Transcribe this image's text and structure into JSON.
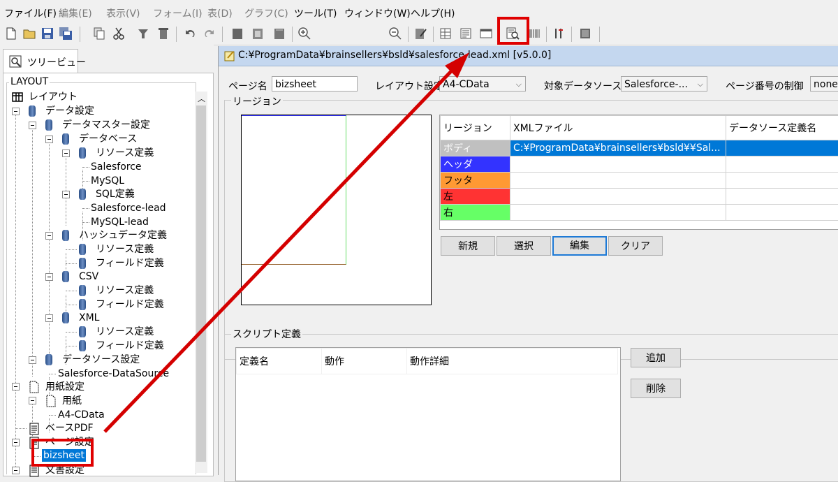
{
  "menu": [
    {
      "label": "ファイル(F)",
      "enabled": true
    },
    {
      "label": "編集(E)",
      "enabled": false
    },
    {
      "label": "表示(V)",
      "enabled": false
    },
    {
      "label": "フォーム(I)",
      "enabled": false
    },
    {
      "label": "表(D)",
      "enabled": false
    },
    {
      "label": "グラフ(C)",
      "enabled": false
    },
    {
      "label": "ツール(T)",
      "enabled": true
    },
    {
      "label": "ウィンドウ(W)",
      "enabled": true
    },
    {
      "label": "ヘルプ(H)",
      "enabled": true
    }
  ],
  "left_tab": {
    "label": "ツリービュー"
  },
  "tree": {
    "group_label": "LAYOUT",
    "nodes": {
      "layout": "レイアウト",
      "data_settings": "データ設定",
      "data_master": "データマスター設定",
      "database": "データベース",
      "resource_def_1": "リソース定義",
      "salesforce": "Salesforce",
      "mysql": "MySQL",
      "sql_def": "SQL定義",
      "salesforce_lead": "Salesforce-lead",
      "mysql_lead": "MySQL-lead",
      "hash_def": "ハッシュデータ定義",
      "resource_def_2": "リソース定義",
      "field_def_2": "フィールド定義",
      "csv": "CSV",
      "resource_def_3": "リソース定義",
      "field_def_3": "フィールド定義",
      "xml": "XML",
      "resource_def_4": "リソース定義",
      "field_def_4": "フィールド定義",
      "datasource_settings": "データソース設定",
      "salesforce_datasource": "Salesforce-DataSource",
      "paper_settings": "用紙設定",
      "paper": "用紙",
      "a4_cdata": "A4-CData",
      "base_pdf": "ベースPDF",
      "page_settings": "ページ設定",
      "bizsheet": "bizsheet",
      "doc_settings": "文書設定"
    }
  },
  "document": {
    "title": "C:¥ProgramData¥brainsellers¥bsld¥salesforce-lead.xml [v5.0.0]",
    "page_name_label": "ページ名",
    "page_name_value": "bizsheet",
    "layout_label": "レイアウト設定",
    "layout_value": "A4-CData",
    "datasource_label": "対象データソース",
    "datasource_value": "Salesforce-...",
    "page_number_label": "ページ番号の制御",
    "page_number_value": "none"
  },
  "region": {
    "group_label": "リージョン",
    "columns": [
      "リージョン",
      "XMLファイル",
      "データソース定義名"
    ],
    "rows": [
      {
        "name": "ボディ",
        "xml": "C:¥ProgramData¥brainsellers¥bsld¥¥Sal...",
        "ds": "",
        "color": "#c0c0c0",
        "text_color": "#ffffff"
      },
      {
        "name": "ヘッダ",
        "xml": "",
        "ds": "",
        "color": "#3333ff",
        "text_color": "#ffffff"
      },
      {
        "name": "フッタ",
        "xml": "",
        "ds": "",
        "color": "#ff9933",
        "text_color": "#000000"
      },
      {
        "name": "左",
        "xml": "",
        "ds": "",
        "color": "#ff3333",
        "text_color": "#000000"
      },
      {
        "name": "右",
        "xml": "",
        "ds": "",
        "color": "#66ff66",
        "text_color": "#000000"
      }
    ],
    "buttons": {
      "new": "新規",
      "select": "選択",
      "edit": "編集",
      "clear": "クリア"
    }
  },
  "script": {
    "group_label": "スクリプト定義",
    "columns": [
      "定義名",
      "動作",
      "動作詳細"
    ],
    "buttons": {
      "add": "追加",
      "delete": "削除"
    }
  },
  "colors": {
    "highlight": "#e00000",
    "selection": "#0078d7",
    "title_bar": "#c4d7ef"
  },
  "icons": [
    "new-file-icon",
    "open-folder-icon",
    "save-icon",
    "save-all-icon",
    "copy-icon",
    "cut-icon",
    "paste-icon",
    "delete-icon",
    "undo-icon",
    "redo-icon",
    "page-icon",
    "page-settings-icon",
    "page-alt-icon",
    "zoom-in-icon",
    "zoom-out-icon",
    "edit-form-icon",
    "table-icon",
    "text-table-icon",
    "window-icon",
    "preview-icon",
    "barcode-icon",
    "tools-icon",
    "stop-icon"
  ]
}
